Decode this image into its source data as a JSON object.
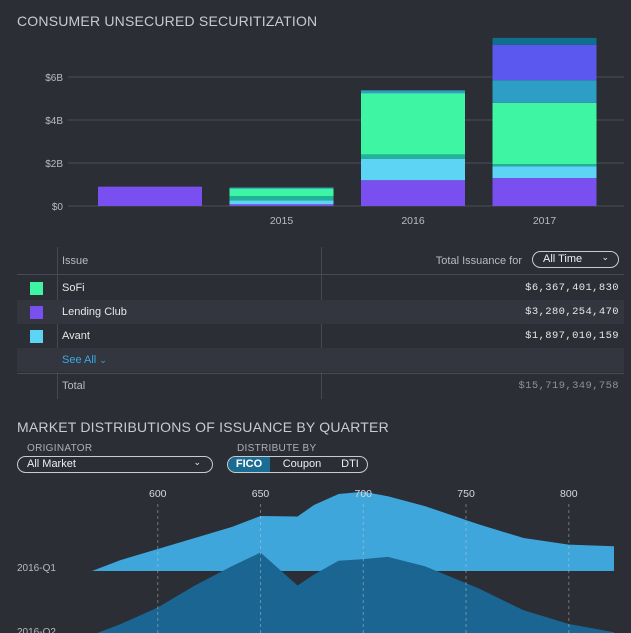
{
  "section1": {
    "title": "CONSUMER UNSECURED SECURITIZATION"
  },
  "chart_data": [
    {
      "type": "bar",
      "stacked": true,
      "categories": [
        "",
        "2015",
        "2016",
        "2017"
      ],
      "y_ticks": [
        "$0",
        "$2B",
        "$4B",
        "$6B"
      ],
      "ylim": [
        0,
        8
      ],
      "grid": true,
      "series": [
        {
          "color": "#7a4ff0",
          "values": [
            0.9,
            0.08,
            1.2,
            1.3
          ]
        },
        {
          "color": "#5ed4f5",
          "values": [
            0,
            0.18,
            1.0,
            0.55
          ]
        },
        {
          "color": "#1fb39a",
          "values": [
            0,
            0.2,
            0.2,
            0.1
          ]
        },
        {
          "color": "#3ef5a3",
          "values": [
            0,
            0.35,
            2.85,
            2.85
          ]
        },
        {
          "color": "#2e9fc4",
          "values": [
            0,
            0.05,
            0.13,
            1.05
          ]
        },
        {
          "color": "#5b58f0",
          "values": [
            0,
            0,
            0,
            1.65
          ]
        },
        {
          "color": "#0e6f8f",
          "values": [
            0,
            0,
            0,
            0.32
          ]
        }
      ]
    },
    {
      "type": "area",
      "x_ticks": [
        "600",
        "650",
        "700",
        "750",
        "800"
      ],
      "xlim": [
        560,
        825
      ],
      "series": [
        {
          "name": "2016-Q1",
          "color": "#3fa6dc",
          "x": [
            568,
            582,
            600,
            618,
            636,
            650,
            668,
            676,
            688,
            700,
            712,
            730,
            756,
            778,
            800,
            822
          ],
          "values": [
            0.0,
            0.2,
            0.4,
            0.6,
            0.8,
            1.0,
            0.99,
            1.2,
            1.4,
            1.44,
            1.36,
            1.18,
            0.85,
            0.6,
            0.48,
            0.45
          ]
        },
        {
          "name": "2016-Q2",
          "color": "#1b6593",
          "x": [
            568,
            582,
            600,
            618,
            636,
            650,
            668,
            676,
            688,
            700,
            712,
            730,
            756,
            778,
            800,
            822
          ],
          "values": [
            0.0,
            0.2,
            0.5,
            0.9,
            1.25,
            1.5,
            0.9,
            1.1,
            1.35,
            1.38,
            1.42,
            1.25,
            0.85,
            0.45,
            0.2,
            0.05
          ]
        }
      ]
    }
  ],
  "table": {
    "header_issue": "Issue",
    "header_total": "Total Issuance for",
    "dropdown_value": "All Time",
    "rows": [
      {
        "name": "SoFi",
        "value": "$6,367,401,830",
        "color": "#3ef5a3"
      },
      {
        "name": "Lending Club",
        "value": "$3,280,254,470",
        "color": "#7a4ff0"
      },
      {
        "name": "Avant",
        "value": "$1,897,010,159",
        "color": "#5ed4f5"
      }
    ],
    "see_all": "See All",
    "total_label": "Total",
    "total_value": "$15,719,349,758"
  },
  "section2": {
    "title": "MARKET DISTRIBUTIONS OF ISSUANCE BY QUARTER",
    "originator_label": "ORIGINATOR",
    "originator_value": "All Market",
    "distribute_label": "DISTRIBUTE BY",
    "options": [
      "FICO",
      "Coupon",
      "DTI"
    ],
    "selected": "FICO"
  }
}
